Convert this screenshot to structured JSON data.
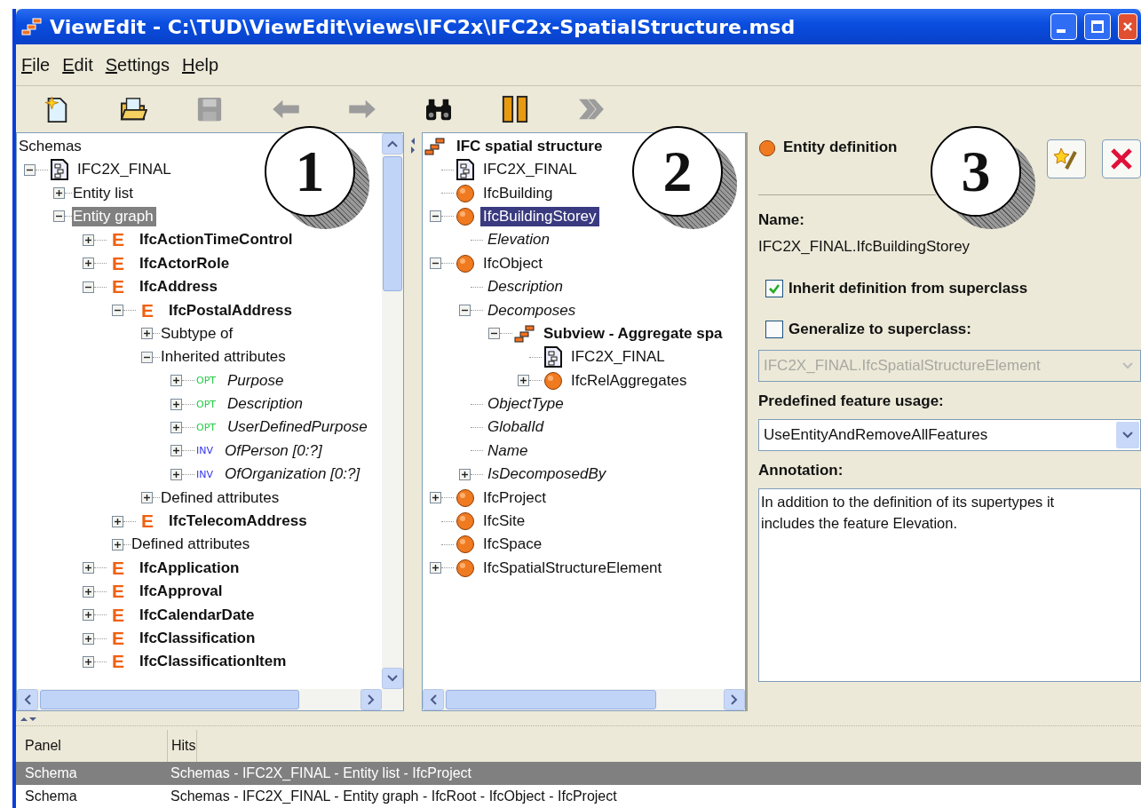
{
  "window": {
    "title": "ViewEdit - C:\\TUD\\ViewEdit\\views\\IFC2x\\IFC2x-SpatialStructure.msd"
  },
  "menu": [
    "File",
    "Edit",
    "Settings",
    "Help"
  ],
  "toolbar": [
    {
      "kind": "new",
      "disabled": false
    },
    {
      "kind": "open",
      "disabled": false
    },
    {
      "kind": "save",
      "disabled": true
    },
    {
      "kind": "back",
      "disabled": true
    },
    {
      "kind": "forward",
      "disabled": true
    },
    {
      "kind": "find",
      "disabled": false
    },
    {
      "kind": "pause",
      "disabled": false
    },
    {
      "kind": "next",
      "disabled": true
    }
  ],
  "left_tree": {
    "title": "Schemas",
    "focused": false,
    "nodes": [
      {
        "label": "IFC2X_FINAL",
        "kind": "schema",
        "expanded": true,
        "selected": false,
        "children": [
          {
            "label": "Entity list",
            "kind": "folder",
            "expanded": false,
            "selected": false
          },
          {
            "label": "Entity graph",
            "kind": "folder",
            "expanded": true,
            "selected": true,
            "children": [
              {
                "label": "IfcActionTimeControl",
                "kind": "entity",
                "marker": "E",
                "expanded": false,
                "selected": false
              },
              {
                "label": "IfcActorRole",
                "kind": "entity",
                "marker": "E",
                "expanded": false,
                "selected": false
              },
              {
                "label": "IfcAddress",
                "kind": "entity",
                "marker": "E",
                "expanded": true,
                "selected": false,
                "children": [
                  {
                    "label": "IfcPostalAddress",
                    "kind": "entity",
                    "marker": "E",
                    "expanded": true,
                    "selected": false,
                    "children": [
                      {
                        "label": "Subtype of",
                        "kind": "folder",
                        "expanded": false,
                        "selected": false
                      },
                      {
                        "label": "Inherited attributes",
                        "kind": "folder",
                        "expanded": true,
                        "selected": false,
                        "children": [
                          {
                            "label": "Purpose",
                            "kind": "attribute",
                            "tag": "OPT",
                            "color": "#22cc44",
                            "expanded": false,
                            "selected": false
                          },
                          {
                            "label": "Description",
                            "kind": "attribute",
                            "tag": "OPT",
                            "color": "#22cc44",
                            "expanded": false,
                            "selected": false
                          },
                          {
                            "label": "UserDefinedPurpose",
                            "kind": "attribute",
                            "tag": "OPT",
                            "color": "#22cc44",
                            "expanded": false,
                            "selected": false
                          },
                          {
                            "label": "OfPerson [0:?]",
                            "kind": "attribute",
                            "tag": "INV",
                            "color": "#3333ee",
                            "expanded": false,
                            "selected": false
                          },
                          {
                            "label": "OfOrganization [0:?]",
                            "kind": "attribute",
                            "tag": "INV",
                            "color": "#3333ee",
                            "expanded": false,
                            "selected": false
                          }
                        ]
                      },
                      {
                        "label": "Defined attributes",
                        "kind": "folder",
                        "expanded": false,
                        "selected": false
                      }
                    ]
                  },
                  {
                    "label": "IfcTelecomAddress",
                    "kind": "entity",
                    "marker": "E",
                    "expanded": false,
                    "selected": false
                  },
                  {
                    "label": "Defined attributes",
                    "kind": "folder",
                    "expanded": false,
                    "selected": false
                  }
                ]
              },
              {
                "label": "IfcApplication",
                "kind": "entity",
                "marker": "E",
                "expanded": false,
                "selected": false
              },
              {
                "label": "IfcApproval",
                "kind": "entity",
                "marker": "E",
                "expanded": false,
                "selected": false
              },
              {
                "label": "IfcCalendarDate",
                "kind": "entity",
                "marker": "E",
                "expanded": false,
                "selected": false
              },
              {
                "label": "IfcClassification",
                "kind": "entity",
                "marker": "E",
                "expanded": false,
                "selected": false
              },
              {
                "label": "IfcClassificationItem",
                "kind": "entity",
                "marker": "E",
                "expanded": false,
                "selected": false
              }
            ]
          }
        ]
      }
    ]
  },
  "middle_tree": {
    "title": "IFC spatial structure",
    "focused": true,
    "nodes": [
      {
        "label": "IFC2X_FINAL",
        "kind": "schema",
        "selected": false
      },
      {
        "label": "IfcBuilding",
        "kind": "object",
        "selected": false
      },
      {
        "label": "IfcBuildingStorey",
        "kind": "object",
        "expanded": true,
        "selected": true,
        "children": [
          {
            "label": "Elevation",
            "kind": "feature",
            "selected": false
          }
        ]
      },
      {
        "label": "IfcObject",
        "kind": "object",
        "expanded": true,
        "selected": false,
        "children": [
          {
            "label": "Description",
            "kind": "feature",
            "selected": false
          },
          {
            "label": "Decomposes",
            "kind": "feature",
            "expanded": true,
            "selected": false,
            "children": [
              {
                "label": "Subview - Aggregate spa",
                "kind": "view",
                "expanded": true,
                "selected": false,
                "children": [
                  {
                    "label": "IFC2X_FINAL",
                    "kind": "schema",
                    "selected": false
                  },
                  {
                    "label": "IfcRelAggregates",
                    "kind": "object",
                    "expanded": false,
                    "selected": false
                  }
                ]
              }
            ]
          },
          {
            "label": "ObjectType",
            "kind": "feature",
            "selected": false
          },
          {
            "label": "GlobalId",
            "kind": "feature",
            "selected": false
          },
          {
            "label": "Name",
            "kind": "feature",
            "selected": false
          },
          {
            "label": "IsDecomposedBy",
            "kind": "feature",
            "expanded": false,
            "selected": false
          }
        ]
      },
      {
        "label": "IfcProject",
        "kind": "object",
        "expanded": false,
        "selected": false
      },
      {
        "label": "IfcSite",
        "kind": "object",
        "selected": false
      },
      {
        "label": "IfcSpace",
        "kind": "object",
        "selected": false
      },
      {
        "label": "IfcSpatialStructureElement",
        "kind": "object",
        "expanded": false,
        "selected": false
      }
    ]
  },
  "definition": {
    "title": "Entity definition",
    "name_label": "Name:",
    "name_value": "IFC2X_FINAL.IfcBuildingStorey",
    "options": [
      {
        "label": "Inherit definition from superclass",
        "checked": true
      },
      {
        "label": "Generalize to superclass:",
        "checked": false
      }
    ],
    "superclass": {
      "value": "IFC2X_FINAL.IfcSpatialStructureElement",
      "disabled": true
    },
    "usage_label": "Predefined feature usage:",
    "usage": {
      "value": "UseEntityAndRemoveAllFeatures",
      "disabled": false
    },
    "annotation_label": "Annotation:",
    "annotation": "In addition to the definition of its supertypes it includes the feature Elevation."
  },
  "callouts": [
    "1",
    "2",
    "3"
  ],
  "hits": {
    "columns": [
      "Panel",
      "Hits"
    ],
    "rows": [
      {
        "panel": "Schema",
        "hit": "Schemas - IFC2X_FINAL - Entity list - IfcProject",
        "selected": true
      },
      {
        "panel": "Schema",
        "hit": "Schemas - IFC2X_FINAL - Entity graph - IfcRoot - IfcObject - IfcProject",
        "selected": false
      }
    ]
  }
}
